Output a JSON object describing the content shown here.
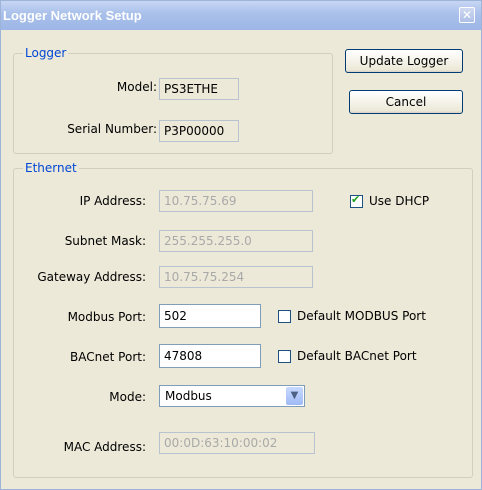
{
  "window": {
    "title": "Logger Network Setup"
  },
  "buttons": {
    "update": "Update Logger",
    "cancel": "Cancel"
  },
  "logger": {
    "legend": "Logger",
    "model_label": "Model:",
    "model_value": "PS3ETHE",
    "serial_label": "Serial Number:",
    "serial_value": "P3P00000"
  },
  "ethernet": {
    "legend": "Ethernet",
    "ip_label": "IP Address:",
    "ip_value": "10.75.75.69",
    "dhcp_label": "Use DHCP",
    "dhcp_checked": true,
    "subnet_label": "Subnet Mask:",
    "subnet_value": "255.255.255.0",
    "gateway_label": "Gateway Address:",
    "gateway_value": "10.75.75.254",
    "modbus_label": "Modbus Port:",
    "modbus_value": "502",
    "default_modbus_label": "Default MODBUS Port",
    "default_modbus_checked": false,
    "bacnet_label": "BACnet Port:",
    "bacnet_value": "47808",
    "default_bacnet_label": "Default BACnet Port",
    "default_bacnet_checked": false,
    "mode_label": "Mode:",
    "mode_value": "Modbus",
    "mac_label": "MAC Address:",
    "mac_value": "00:0D:63:10:00:02"
  }
}
